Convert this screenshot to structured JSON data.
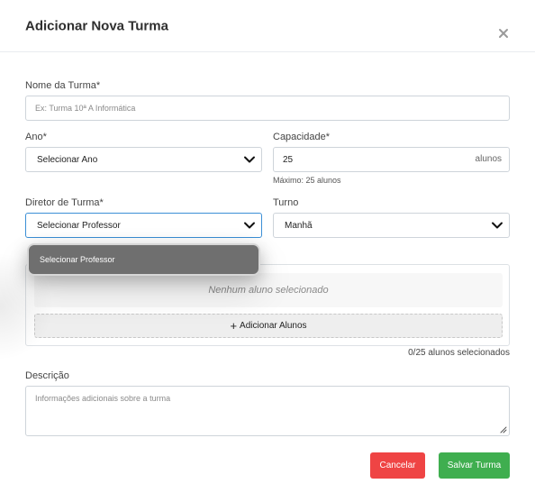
{
  "modal": {
    "title": "Adicionar Nova Turma",
    "close_icon": "close-icon"
  },
  "fields": {
    "nome": {
      "label": "Nome da Turma*",
      "placeholder": "Ex: Turma 10ª A Informática"
    },
    "ano": {
      "label": "Ano*",
      "value": "Selecionar Ano"
    },
    "capacidade": {
      "label": "Capacidade*",
      "value": "25",
      "suffix": "alunos",
      "hint": "Máximo: 25 alunos"
    },
    "diretor": {
      "label": "Diretor de Turma*",
      "value": "Selecionar Professor",
      "dropdown_options": [
        "Selecionar Professor"
      ]
    },
    "turno": {
      "label": "Turno",
      "value": "Manhã"
    },
    "alunos": {
      "empty_text": "Nenhum aluno selecionado",
      "add_button": "Adicionar Alunos",
      "counter": "0/25 alunos selecionados"
    },
    "descricao": {
      "label": "Descrição",
      "placeholder": "Informações adicionais sobre a turma"
    }
  },
  "actions": {
    "cancel": "Cancelar",
    "save": "Salvar Turma"
  },
  "colors": {
    "cancel": "#ef4444",
    "save": "#3fae4f",
    "focus_border": "#3b8fd6",
    "dropdown_bg": "#6f6f6f"
  }
}
